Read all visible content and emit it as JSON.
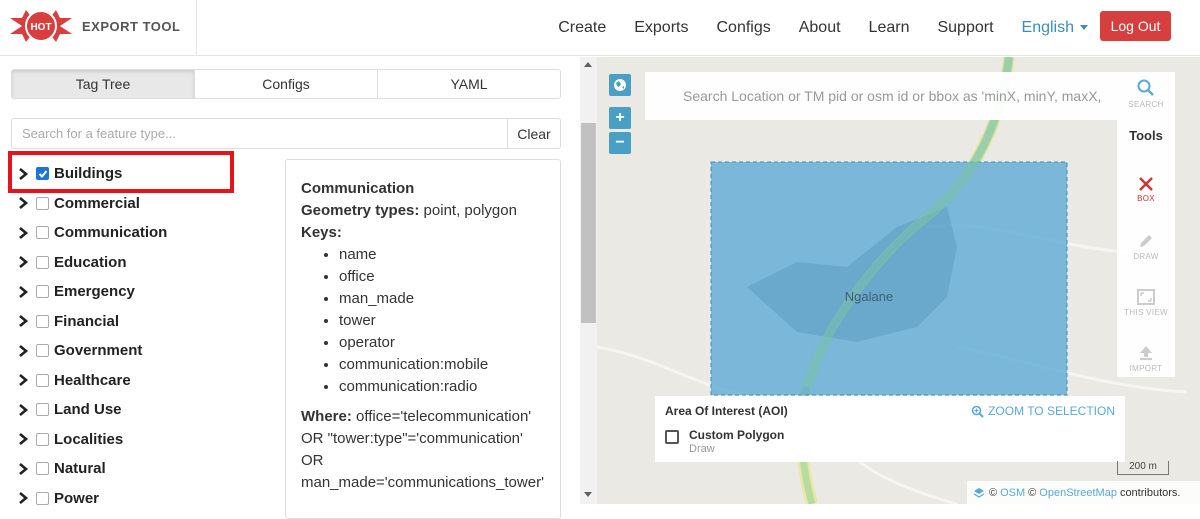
{
  "header": {
    "logo_text": "EXPORT TOOL",
    "logo_badge": "HOT",
    "nav": [
      "Create",
      "Exports",
      "Configs",
      "About",
      "Learn",
      "Support"
    ],
    "language": "English",
    "logout_label": "Log Out"
  },
  "left": {
    "tabs": [
      {
        "label": "Tag Tree",
        "active": true
      },
      {
        "label": "Configs",
        "active": false
      },
      {
        "label": "YAML",
        "active": false
      }
    ],
    "search": {
      "placeholder": "Search for a feature type...",
      "value": ""
    },
    "clear_label": "Clear",
    "tree": [
      {
        "label": "Buildings",
        "checked": true
      },
      {
        "label": "Commercial",
        "checked": false
      },
      {
        "label": "Communication",
        "checked": false
      },
      {
        "label": "Education",
        "checked": false
      },
      {
        "label": "Emergency",
        "checked": false
      },
      {
        "label": "Financial",
        "checked": false
      },
      {
        "label": "Government",
        "checked": false
      },
      {
        "label": "Healthcare",
        "checked": false
      },
      {
        "label": "Land Use",
        "checked": false
      },
      {
        "label": "Localities",
        "checked": false
      },
      {
        "label": "Natural",
        "checked": false
      },
      {
        "label": "Power",
        "checked": false
      }
    ],
    "detail": {
      "title": "Communication",
      "geometry_label": "Geometry types:",
      "geometry_value": "point, polygon",
      "keys_label": "Keys:",
      "keys": [
        "name",
        "office",
        "man_made",
        "tower",
        "operator",
        "communication:mobile",
        "communication:radio"
      ],
      "where_label": "Where:",
      "where_lines": [
        "office='telecommunication'",
        "OR \"tower:type\"='communication'",
        "OR",
        "man_made='communications_tower'"
      ]
    }
  },
  "map": {
    "search_placeholder": "Search Location or TM pid or osm id or bbox as 'minX, minY, maxX, maxY'",
    "search_label": "SEARCH",
    "tools_heading": "Tools",
    "tools": [
      {
        "icon": "x-icon",
        "label": "BOX",
        "active": true
      },
      {
        "icon": "pencil-icon",
        "label": "DRAW",
        "active": false
      },
      {
        "icon": "fullscreen-icon",
        "label": "THIS VIEW",
        "active": false
      },
      {
        "icon": "upload-icon",
        "label": "IMPORT",
        "active": false
      }
    ],
    "place_label": "Ngalane",
    "aoi": {
      "title": "Area Of Interest (AOI)",
      "zoom_label": "ZOOM TO SELECTION",
      "name": "Custom Polygon",
      "sub": "Draw"
    },
    "scale_label": "200 m",
    "attribution": {
      "prefix": "©",
      "osm": "OSM",
      "mid": "©",
      "osm_full": "OpenStreetMap",
      "suffix": "contributors."
    },
    "colors": {
      "aoi_fill": "#5aa9d6",
      "road": "#b8dca0",
      "accent": "#4a9fc4",
      "logout": "#d73f3f"
    }
  }
}
